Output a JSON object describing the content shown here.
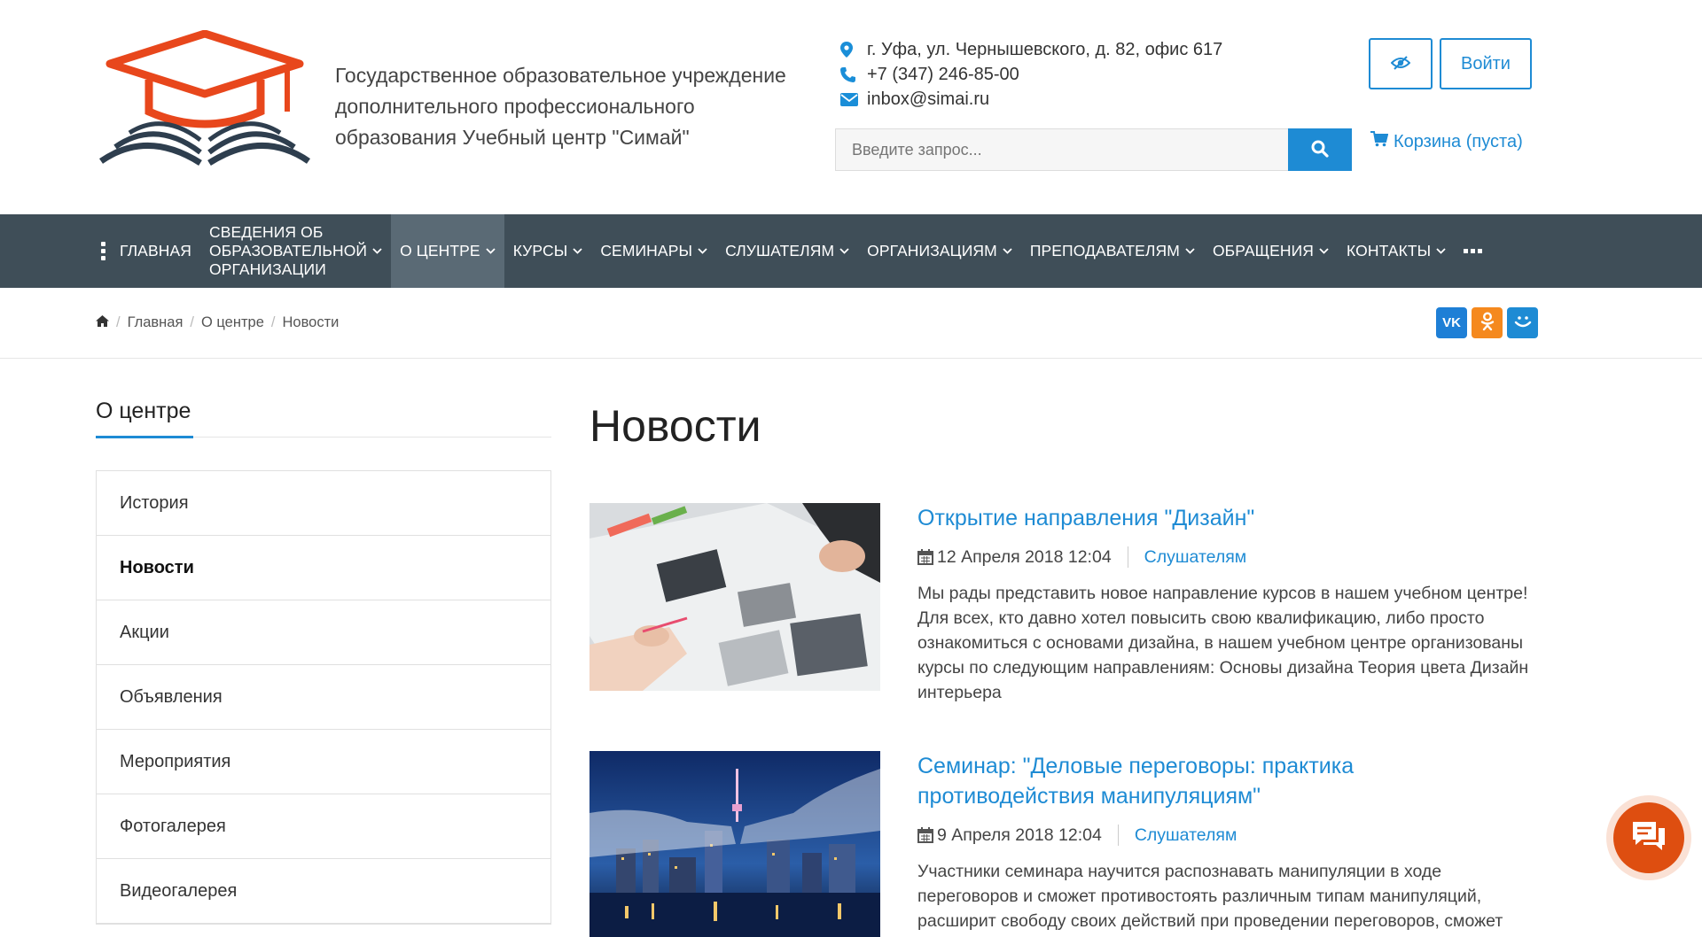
{
  "header": {
    "org_name": "Государственное образовательное учреждение\nдополнительного профессионального\nобразования Учебный центр \"Симай\"",
    "address": "г. Уфа, ул. Чернышевского, д. 82, офис 617",
    "phone": "+7 (347) 246-85-00",
    "email": "inbox@simai.ru",
    "search_placeholder": "Введите запрос...",
    "login_label": "Войти",
    "cart_label": "Корзина (пуста)"
  },
  "nav": {
    "items": [
      {
        "label": "Главная"
      },
      {
        "label": "Сведения об\nобразовательной\nорганизации"
      },
      {
        "label": "О центре"
      },
      {
        "label": "Курсы"
      },
      {
        "label": "Семинары"
      },
      {
        "label": "Слушателям"
      },
      {
        "label": "Организациям"
      },
      {
        "label": "Преподавателям"
      },
      {
        "label": "Обращения"
      },
      {
        "label": "Контакты"
      }
    ]
  },
  "breadcrumb": [
    "Главная",
    "О центре",
    "Новости"
  ],
  "social": [
    {
      "name": "vk",
      "label": "VK",
      "color": "#1e7fd6"
    },
    {
      "name": "ok",
      "label": "ok",
      "color": "#f5891e"
    },
    {
      "name": "mailru",
      "label": "☺",
      "color": "#1e8bd4"
    }
  ],
  "sidebar": {
    "title": "О центре",
    "items": [
      {
        "label": "История"
      },
      {
        "label": "Новости"
      },
      {
        "label": "Акции"
      },
      {
        "label": "Объявления"
      },
      {
        "label": "Мероприятия"
      },
      {
        "label": "Фотогалерея"
      },
      {
        "label": "Видеогалерея"
      }
    ]
  },
  "main": {
    "title": "Новости",
    "news": [
      {
        "title": "Открытие направления \"Дизайн\"",
        "date": "12 Апреля 2018 12:04",
        "category": "Слушателям",
        "text": "Мы рады представить новое направление курсов в нашем учебном центре! Для всех, кто давно хотел повысить свою квалификацию, либо просто ознакомиться с основами дизайна, в нашем учебном центре организованы курсы по следующим направлениям: Основы дизайна Теория цвета Дизайн интерьера"
      },
      {
        "title": "Семинар: \"Деловые переговоры: практика противодействия манипуляциям\"",
        "date": "9 Апреля 2018 12:04",
        "category": "Слушателям",
        "text": "Участники семинара научится распознавать манипуляции в ходе переговоров и сможет противостоять различным типам манипуляций, расширит свободу своих действий при проведении переговоров, сможет"
      }
    ]
  },
  "colors": {
    "accent": "#1e8bd4",
    "nav_bg": "#3f4e58",
    "logo_orange": "#e8471c",
    "logo_dark": "#2e3e4e",
    "chat": "#de4e10"
  }
}
